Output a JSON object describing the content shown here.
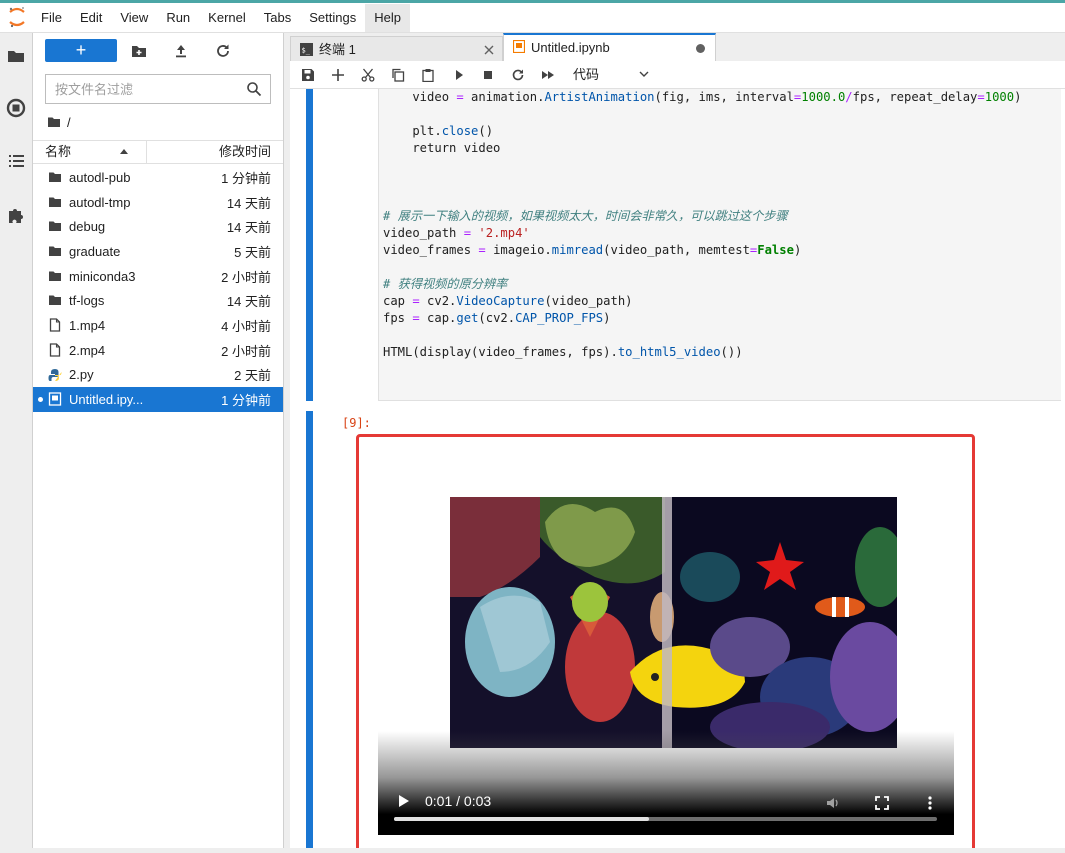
{
  "menubar": {
    "items": [
      "File",
      "Edit",
      "View",
      "Run",
      "Kernel",
      "Tabs",
      "Settings",
      "Help"
    ],
    "active_index": 7
  },
  "filebrowser": {
    "new_label": "+",
    "search_placeholder": "按文件名过滤",
    "breadcrumb": "/",
    "header_name": "名称",
    "header_time": "修改时间",
    "files": [
      {
        "name": "autodl-pub",
        "time": "1 分钟前",
        "type": "folder"
      },
      {
        "name": "autodl-tmp",
        "time": "14 天前",
        "type": "folder"
      },
      {
        "name": "debug",
        "time": "14 天前",
        "type": "folder"
      },
      {
        "name": "graduate",
        "time": "5 天前",
        "type": "folder"
      },
      {
        "name": "miniconda3",
        "time": "2 小时前",
        "type": "folder"
      },
      {
        "name": "tf-logs",
        "time": "14 天前",
        "type": "folder"
      },
      {
        "name": "1.mp4",
        "time": "4 小时前",
        "type": "file"
      },
      {
        "name": "2.mp4",
        "time": "2 小时前",
        "type": "file"
      },
      {
        "name": "2.py",
        "time": "2 天前",
        "type": "python"
      },
      {
        "name": "Untitled.ipy...",
        "time": "1 分钟前",
        "type": "notebook",
        "selected": true
      }
    ]
  },
  "tabs": [
    {
      "label": "终端 1",
      "active": false
    },
    {
      "label": "Untitled.ipynb",
      "active": true
    }
  ],
  "toolbar": {
    "cell_type": "代码"
  },
  "code_lines": [
    "    video = animation.ArtistAnimation(fig, ims, interval=1000.0/fps, repeat_delay=1000)",
    "",
    "    plt.close()",
    "    return video",
    "",
    "",
    "",
    "# 展示一下输入的视频，如果视频太大，时间会非常久，可以跳过这个步骤",
    "video_path = '2.mp4'",
    "video_frames = imageio.mimread(video_path, memtest=False)",
    "",
    "# 获得视频的原分辨率",
    "cap = cv2.VideoCapture(video_path)",
    "fps = cap.get(cv2.CAP_PROP_FPS)",
    "",
    "HTML(display(video_frames, fps).to_html5_video())"
  ],
  "output": {
    "prompt": "[9]:",
    "video_time": "0:01 / 0:03",
    "progress": 0.47
  },
  "colors": {
    "accent": "#1976d2",
    "highlight": "#e53935"
  }
}
